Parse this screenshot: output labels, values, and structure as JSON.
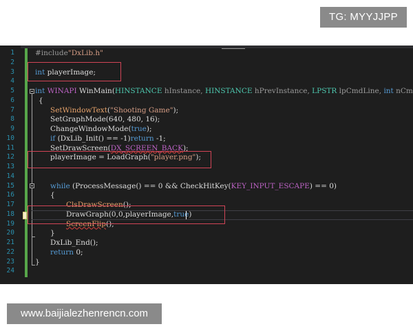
{
  "watermarks": {
    "tg_label": "TG: MYYJJPP",
    "url_label": "www.baijialezhenrencn.com"
  },
  "colors": {
    "editor_background": "#1e1e1e",
    "line_number": "#2b91af",
    "keyword": "#569cd6",
    "function": "#e7a36b",
    "string": "#d69d85",
    "type": "#4ec9b0",
    "macro": "#bd63c5",
    "highlight_box": "#d14456",
    "change_bar": "#57a64a"
  },
  "editor": {
    "line_numbers": [
      "1",
      "2",
      "3",
      "4",
      "5",
      "6",
      "7",
      "8",
      "9",
      "10",
      "11",
      "12",
      "13",
      "14",
      "15",
      "16",
      "17",
      "18",
      "19",
      "20",
      "21",
      "22",
      "23",
      "24"
    ],
    "lines": [
      [
        {
          "t": "#include",
          "c": "pre"
        },
        {
          "t": "\"DxLib.h\"",
          "c": "string"
        }
      ],
      [],
      [
        {
          "t": "int",
          "c": "keyword"
        },
        {
          "t": " playerImage;",
          "c": "plain"
        }
      ],
      [],
      [
        {
          "t": "int",
          "c": "keyword"
        },
        {
          "t": " ",
          "c": "plain"
        },
        {
          "t": "WINAPI",
          "c": "macro"
        },
        {
          "t": " WinMain(",
          "c": "plain"
        },
        {
          "t": "HINSTANCE",
          "c": "type"
        },
        {
          "t": " hInstance, ",
          "c": "param"
        },
        {
          "t": "HINSTANCE",
          "c": "type"
        },
        {
          "t": " hPrevInstance, ",
          "c": "param"
        },
        {
          "t": "LPSTR",
          "c": "type"
        },
        {
          "t": " lpCmdLine, ",
          "c": "param"
        },
        {
          "t": "int",
          "c": "keyword"
        },
        {
          "t": " nCmdShow)",
          "c": "param"
        }
      ],
      [
        {
          "t": "{",
          "c": "plain"
        }
      ],
      [
        {
          "t": "SetWindowText",
          "c": "func"
        },
        {
          "t": "(",
          "c": "plain"
        },
        {
          "t": "\"Shooting Game\"",
          "c": "string"
        },
        {
          "t": ");",
          "c": "plain"
        }
      ],
      [
        {
          "t": "SetGraphMode(640, 480, 16);",
          "c": "plain"
        }
      ],
      [
        {
          "t": "ChangeWindowMode(",
          "c": "plain"
        },
        {
          "t": "true",
          "c": "keyword"
        },
        {
          "t": ");",
          "c": "plain"
        }
      ],
      [
        {
          "t": "if",
          "c": "keyword"
        },
        {
          "t": " (DxLib_Init() == -1)",
          "c": "plain"
        },
        {
          "t": "return",
          "c": "keyword"
        },
        {
          "t": " -1;",
          "c": "plain"
        }
      ],
      [
        {
          "t": "SetDrawScreen(",
          "c": "plain"
        },
        {
          "t": "DX_SCREEN_BACK",
          "c": "macro"
        },
        {
          "t": ");",
          "c": "plain"
        }
      ],
      [
        {
          "t": "playerImage = LoadGraph(",
          "c": "plain"
        },
        {
          "t": "\"player.png\"",
          "c": "string"
        },
        {
          "t": ");",
          "c": "plain"
        }
      ],
      [],
      [],
      [
        {
          "t": "while",
          "c": "keyword"
        },
        {
          "t": " (ProcessMessage() == 0 && CheckHitKey(",
          "c": "plain"
        },
        {
          "t": "KEY_INPUT_ESCAPE",
          "c": "macro"
        },
        {
          "t": ") == 0)",
          "c": "plain"
        }
      ],
      [
        {
          "t": "{",
          "c": "plain"
        }
      ],
      [
        {
          "t": "ClsDrawScreen",
          "c": "func"
        },
        {
          "t": "();",
          "c": "plain"
        }
      ],
      [
        {
          "t": "DrawGraph(0,0,playerImage,",
          "c": "plain"
        },
        {
          "t": "true",
          "c": "keyword"
        },
        {
          "t": ")",
          "c": "plain"
        }
      ],
      [
        {
          "t": "ScreenFlip",
          "c": "func"
        },
        {
          "t": "();",
          "c": "plain"
        }
      ],
      [
        {
          "t": "}",
          "c": "plain"
        }
      ],
      [
        {
          "t": "DxLib_End();",
          "c": "plain"
        }
      ],
      [
        {
          "t": "return",
          "c": "keyword"
        },
        {
          "t": " 0;",
          "c": "plain"
        }
      ],
      [
        {
          "t": "}",
          "c": "plain"
        }
      ],
      []
    ]
  }
}
